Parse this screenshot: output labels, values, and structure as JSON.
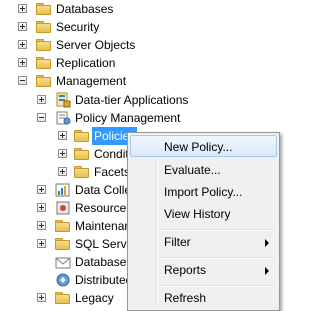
{
  "tree": {
    "items": [
      {
        "label": "Databases",
        "expander": "+"
      },
      {
        "label": "Security",
        "expander": "+"
      },
      {
        "label": "Server Objects",
        "expander": "+"
      },
      {
        "label": "Replication",
        "expander": "+"
      },
      {
        "label": "Management",
        "expander": "-"
      },
      {
        "label": "Data-tier Applications",
        "expander": "+"
      },
      {
        "label": "Policy Management",
        "expander": "-"
      },
      {
        "label": "Policies",
        "expander": "+"
      },
      {
        "label": "Conditions",
        "expander": "+"
      },
      {
        "label": "Facets",
        "expander": "+"
      },
      {
        "label": "Data Collection",
        "expander": "+"
      },
      {
        "label": "Resource Governor",
        "expander": "+"
      },
      {
        "label": "Maintenance Plans",
        "expander": "+"
      },
      {
        "label": "SQL Server Logs",
        "expander": "+"
      },
      {
        "label": "Database Mail",
        "expander": ""
      },
      {
        "label": "Distributed Transaction Coordinator",
        "expander": ""
      },
      {
        "label": "Legacy",
        "expander": "+"
      }
    ]
  },
  "context_menu": {
    "items": [
      {
        "label": "New Policy..."
      },
      {
        "label": "Evaluate..."
      },
      {
        "label": "Import Policy..."
      },
      {
        "label": "View History"
      },
      {
        "label": "Filter"
      },
      {
        "label": "Reports"
      },
      {
        "label": "Refresh"
      }
    ]
  },
  "colors": {
    "selection": "#3399ff",
    "menu_background": "#f0f0f0",
    "menu_hover": "#dbe9fb"
  }
}
